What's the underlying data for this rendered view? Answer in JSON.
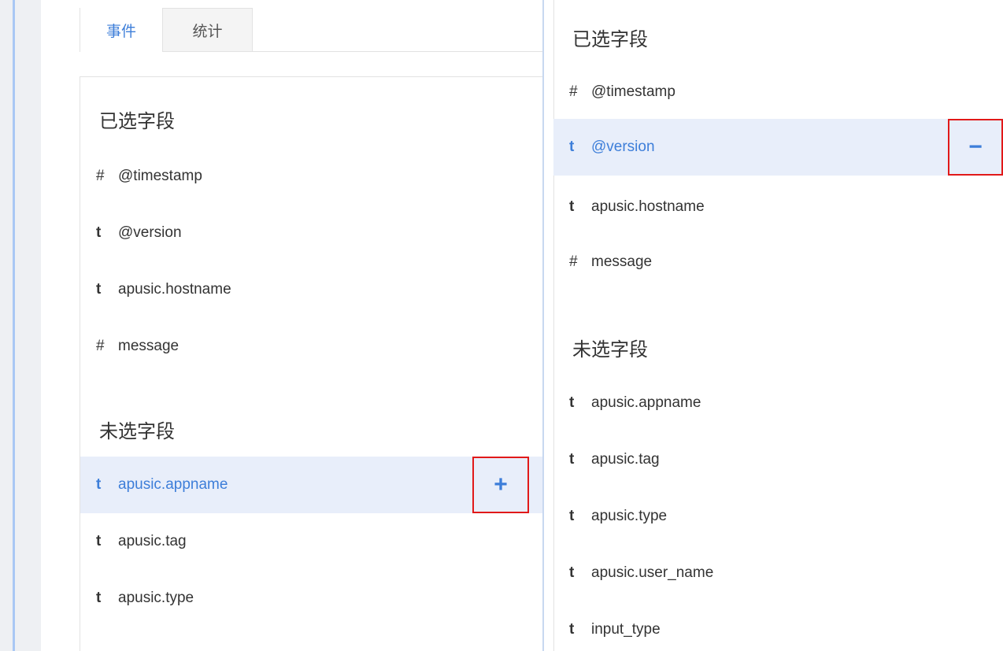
{
  "tabs": [
    {
      "label": "事件"
    },
    {
      "label": "统计"
    }
  ],
  "left_panel": {
    "selected_title": "已选字段",
    "selected_fields": [
      {
        "type": "#",
        "name": "@timestamp"
      },
      {
        "type": "t",
        "name": "@version"
      },
      {
        "type": "t",
        "name": "apusic.hostname"
      },
      {
        "type": "#",
        "name": "message"
      }
    ],
    "unselected_title": "未选字段",
    "unselected_fields": [
      {
        "type": "t",
        "name": "apusic.appname",
        "action": "+"
      },
      {
        "type": "t",
        "name": "apusic.tag"
      },
      {
        "type": "t",
        "name": "apusic.type"
      }
    ]
  },
  "right_panel": {
    "selected_title": "已选字段",
    "selected_fields": [
      {
        "type": "#",
        "name": "@timestamp"
      },
      {
        "type": "t",
        "name": "@version",
        "action": "−"
      },
      {
        "type": "t",
        "name": "apusic.hostname"
      },
      {
        "type": "#",
        "name": "message"
      }
    ],
    "unselected_title": "未选字段",
    "unselected_fields": [
      {
        "type": "t",
        "name": "apusic.appname"
      },
      {
        "type": "t",
        "name": "apusic.tag"
      },
      {
        "type": "t",
        "name": "apusic.type"
      },
      {
        "type": "t",
        "name": "apusic.user_name"
      },
      {
        "type": "t",
        "name": "input_type"
      }
    ]
  },
  "colors": {
    "accent": "#3d7ed9",
    "hover_bg": "#e8eefa",
    "highlight_box": "#e11919"
  }
}
